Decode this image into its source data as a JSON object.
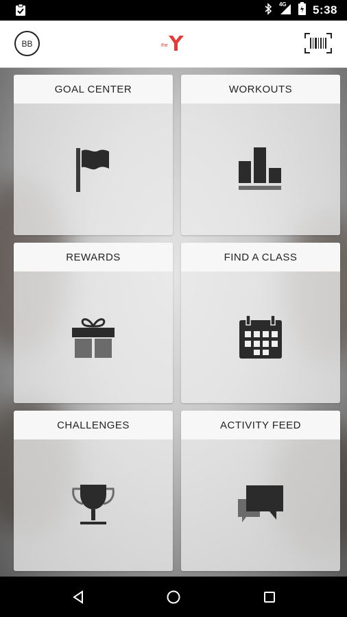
{
  "status_bar": {
    "time": "5:38",
    "network_label": "4G",
    "icons": [
      "notification-clipboard-icon",
      "bluetooth-icon",
      "signal-icon",
      "battery-icon"
    ]
  },
  "app_bar": {
    "avatar_initials": "BB",
    "logo": "ymca-logo",
    "logo_text": "the",
    "brand_color": "#e53935",
    "actions": [
      "barcode-scanner-icon"
    ]
  },
  "tiles": [
    {
      "label": "GOAL CENTER",
      "icon": "flag-icon"
    },
    {
      "label": "WORKOUTS",
      "icon": "bar-chart-icon"
    },
    {
      "label": "REWARDS",
      "icon": "gift-icon"
    },
    {
      "label": "FIND A CLASS",
      "icon": "calendar-icon"
    },
    {
      "label": "CHALLENGES",
      "icon": "trophy-icon"
    },
    {
      "label": "ACTIVITY FEED",
      "icon": "chat-bubbles-icon"
    }
  ],
  "nav_bar": {
    "buttons": [
      "back-icon",
      "home-icon",
      "recents-icon"
    ]
  }
}
